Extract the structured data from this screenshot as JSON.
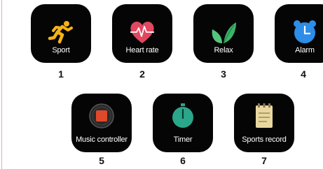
{
  "apps": [
    {
      "label": "Sport",
      "number": "1",
      "icon": "running-person-icon",
      "color": "#f5b318"
    },
    {
      "label": "Heart rate",
      "number": "2",
      "icon": "heart-ecg-icon",
      "color": "#e04860"
    },
    {
      "label": "Relax",
      "number": "3",
      "icon": "leaves-icon",
      "color": "#3bb36a"
    },
    {
      "label": "Alarm",
      "number": "4",
      "icon": "alarm-clock-icon",
      "color": "#2d8de8"
    },
    {
      "label": "Music controller",
      "number": "5",
      "icon": "music-disc-icon",
      "color": "#e0482a"
    },
    {
      "label": "Timer",
      "number": "6",
      "icon": "stopwatch-icon",
      "color": "#2aa68a"
    },
    {
      "label": "Sports record",
      "number": "7",
      "icon": "notepad-icon",
      "color": "#e8d8a0"
    }
  ]
}
